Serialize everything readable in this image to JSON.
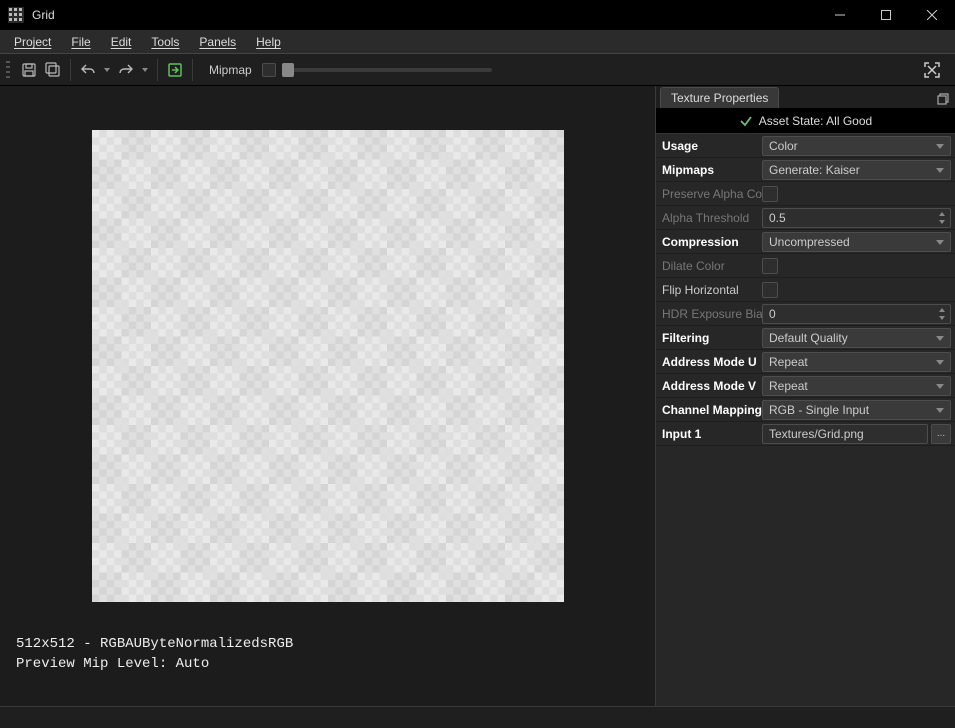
{
  "window": {
    "title": "Grid"
  },
  "menubar": [
    "Project",
    "File",
    "Edit",
    "Tools",
    "Panels",
    "Help"
  ],
  "toolbar": {
    "mipmap_label": "Mipmap"
  },
  "viewport": {
    "status_line1": "512x512 - RGBAUByteNormalizedsRGB",
    "status_line2": "Preview Mip Level: Auto"
  },
  "panel": {
    "tab_title": "Texture Properties",
    "asset_state": "Asset State: All Good",
    "rows": {
      "usage": {
        "label": "Usage",
        "value": "Color"
      },
      "mipmaps": {
        "label": "Mipmaps",
        "value": "Generate: Kaiser"
      },
      "preserve_alpha": {
        "label": "Preserve Alpha Coverage"
      },
      "alpha_threshold": {
        "label": "Alpha Threshold",
        "value": "0.5"
      },
      "compression": {
        "label": "Compression",
        "value": "Uncompressed"
      },
      "dilate_color": {
        "label": "Dilate Color"
      },
      "flip_horizontal": {
        "label": "Flip Horizontal"
      },
      "hdr_exposure": {
        "label": "HDR Exposure Bias",
        "value": "0"
      },
      "filtering": {
        "label": "Filtering",
        "value": "Default Quality"
      },
      "address_u": {
        "label": "Address Mode U",
        "value": "Repeat"
      },
      "address_v": {
        "label": "Address Mode V",
        "value": "Repeat"
      },
      "channel_mapping": {
        "label": "Channel Mapping",
        "value": "RGB - Single Input"
      },
      "input1": {
        "label": "Input 1",
        "value": "Textures/Grid.png"
      }
    }
  }
}
